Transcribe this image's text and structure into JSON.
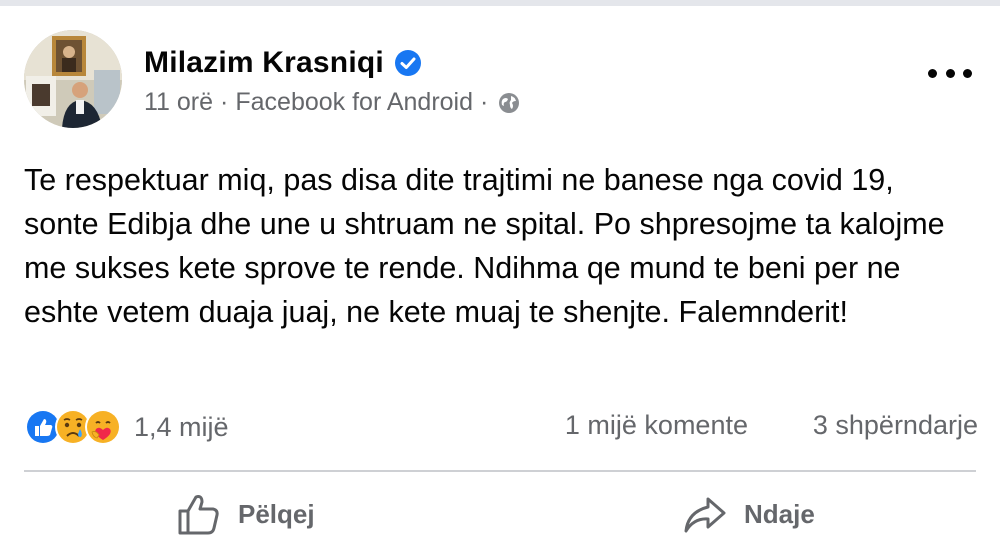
{
  "post": {
    "author": "Milazim Krasniqi",
    "time": "11 orë",
    "source": "Facebook for Android",
    "separator": "·",
    "text": "Te respektuar miq, pas disa dite trajtimi ne banese nga covid 19, sonte Edibja dhe une u shtruam ne spital. Po shpresojme ta kalojme me sukses kete sprove te rende. Ndihma qe mund te beni per ne eshte vetem duaja juaj, ne kete muaj te shenjte. Falemnderit!"
  },
  "stats": {
    "reactions_count": "1,4 mijë",
    "reaction_icons": [
      "like-icon",
      "sad-icon",
      "care-icon"
    ],
    "comments": "1 mijë komente",
    "shares": "3 shpërndarje"
  },
  "actions": {
    "like_label": "Pëlqej",
    "share_label": "Ndaje"
  },
  "colors": {
    "verified": "#1877f2",
    "secondary_text": "#65676b",
    "divider": "#ced0d4"
  }
}
